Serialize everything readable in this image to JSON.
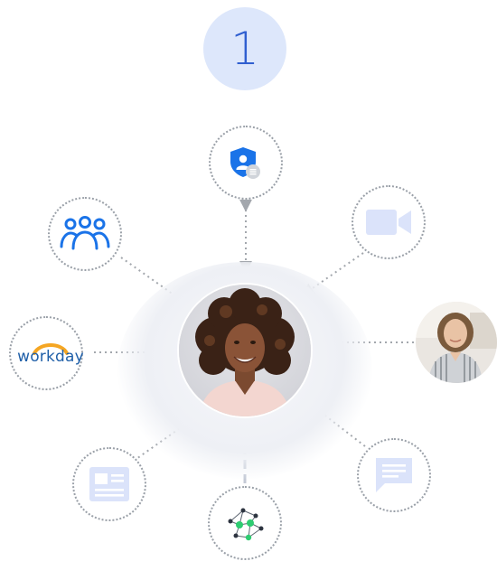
{
  "step_badge": {
    "number": "1"
  },
  "workday": {
    "wordmark": "workday"
  },
  "colors": {
    "badge_bg": "#dde7fb",
    "badge_text": "#2f5fd0",
    "arrow": "#a3a7ad",
    "icon_light": "#dbe3fa",
    "icon_blue": "#1a73e8",
    "workday_blue": "#1f5fa8",
    "workday_orange": "#f5a623",
    "knowledge_green": "#2ecc71"
  },
  "icons": {
    "top": "shield-user-icon",
    "top_left": "people-group-icon",
    "left": "workday-logo",
    "bottom_left": "article-icon",
    "bottom": "knowledge-graph-icon",
    "bottom_right": "chat-message-icon",
    "right": "employee-photo",
    "top_right": "video-camera-icon",
    "center": "person-photo"
  }
}
